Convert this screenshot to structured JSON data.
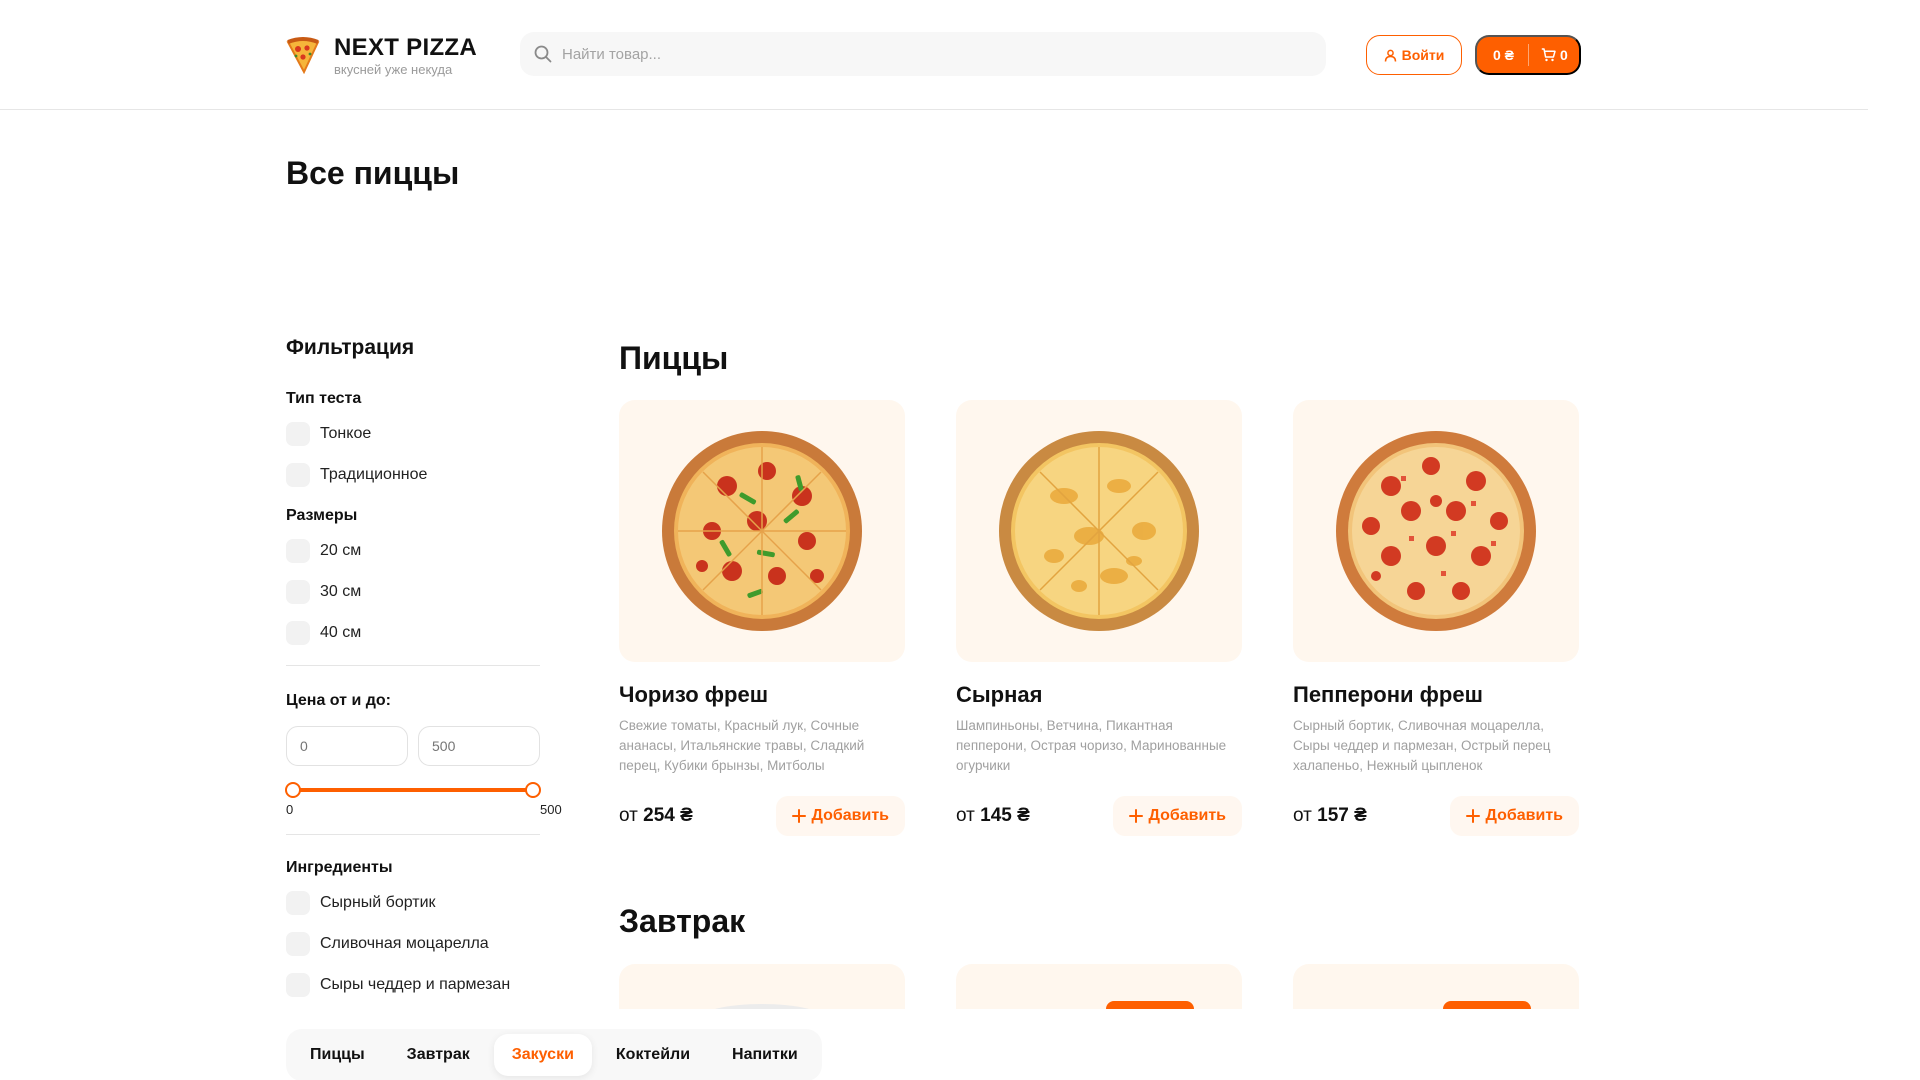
{
  "header": {
    "logo_title": "NEXT PIZZA",
    "logo_subtitle": "вкусней уже некуда",
    "search_placeholder": "Найти товар...",
    "login_label": "Войти",
    "cart_sum": "0 ₴",
    "cart_count": "0"
  },
  "page_title": "Все пиццы",
  "filters": {
    "title": "Фильтрация",
    "dough": {
      "title": "Тип теста",
      "options": [
        "Тонкое",
        "Традиционное"
      ]
    },
    "sizes": {
      "title": "Размеры",
      "options": [
        "20 см",
        "30 см",
        "40 см"
      ]
    },
    "price": {
      "title": "Цена от и до:",
      "from_placeholder": "0",
      "to_placeholder": "500",
      "min_label": "0",
      "max_label": "500",
      "range_min": 0,
      "range_max": 500,
      "selected_from": 0,
      "selected_to": 500
    },
    "ingredients": {
      "title": "Ингредиенты",
      "options": [
        "Сырный бортик",
        "Сливочная моцарелла",
        "Сыры чеддер и пармезан"
      ]
    }
  },
  "sections": [
    {
      "title": "Пиццы",
      "products": [
        {
          "name": "Чоризо фреш",
          "description": "Свежие томаты, Красный лук, Сочные ананасы, Итальянские травы, Сладкий перец, Кубики брынзы, Митболы",
          "price_prefix": "от",
          "price": "254 ₴",
          "add_label": "Добавить",
          "image": "pizza-chorizo-image"
        },
        {
          "name": "Сырная",
          "description": "Шампиньоны, Ветчина, Пикантная пепперони, Острая чоризо, Маринованные огурчики",
          "price_prefix": "от",
          "price": "145 ₴",
          "add_label": "Добавить",
          "image": "pizza-cheese-image"
        },
        {
          "name": "Пепперони фреш",
          "description": "Сырный бортик, Сливочная моцарелла, Сыры чеддер и пармезан, Острый перец халапеньо, Нежный цыпленок",
          "price_prefix": "от",
          "price": "157 ₴",
          "add_label": "Добавить",
          "image": "pizza-pepperoni-image"
        }
      ]
    },
    {
      "title": "Завтрак",
      "products": []
    }
  ],
  "categories": [
    {
      "label": "Пиццы",
      "active": false
    },
    {
      "label": "Завтрак",
      "active": false
    },
    {
      "label": "Закуски",
      "active": true
    },
    {
      "label": "Коктейли",
      "active": false
    },
    {
      "label": "Напитки",
      "active": false
    }
  ],
  "colors": {
    "accent": "#fe5f00",
    "card_bg": "#fff7ee",
    "muted_text": "#a0a0a0"
  }
}
